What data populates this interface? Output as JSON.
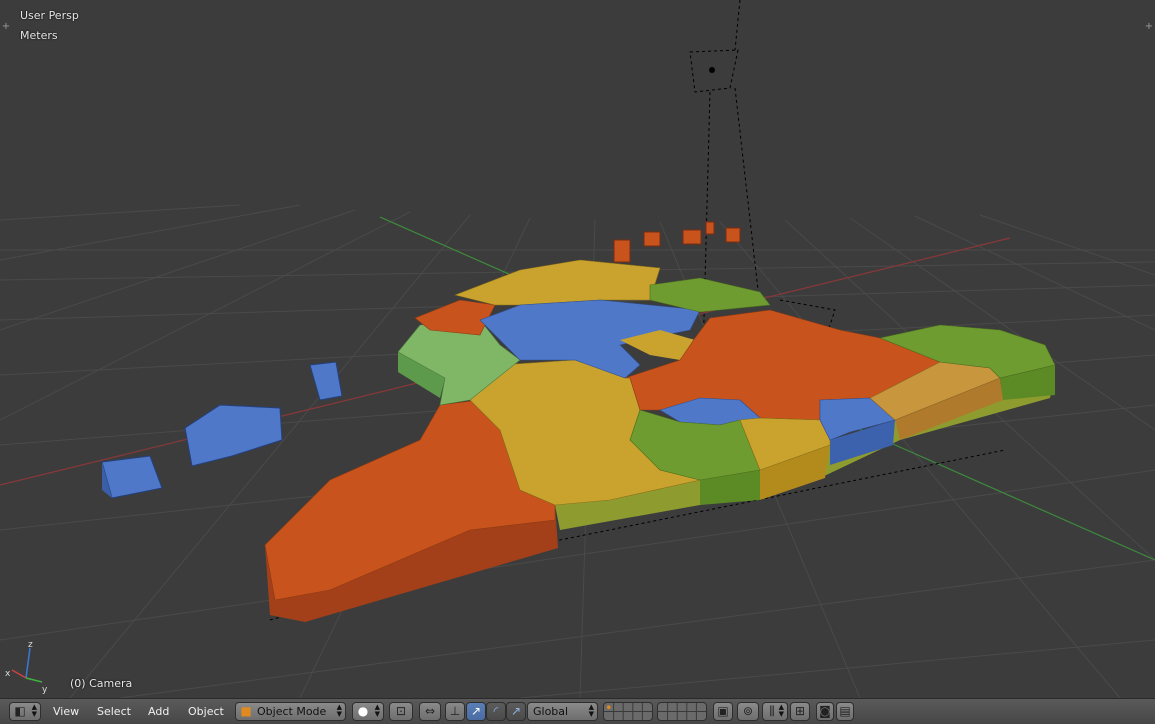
{
  "viewport": {
    "view_name": "User Persp",
    "units": "Meters",
    "active_object": "(0) Camera",
    "axis_gizmo": {
      "x": "x",
      "y": "y",
      "z": "z"
    }
  },
  "header": {
    "editor_type_icon": "3d-view-icon",
    "menus": {
      "view": "View",
      "select": "Select",
      "add": "Add",
      "object": "Object"
    },
    "mode": {
      "label": "Object Mode",
      "icon": "object-mode-cube-icon"
    },
    "shading_icon": "solid-shading-icon",
    "pivot_icon": "pivot-point-icon",
    "manipulator_icons": [
      "manipulator-toggle-icon",
      "translate-icon",
      "rotate-icon",
      "scale-icon"
    ],
    "orientation": "Global",
    "layer_count": 20,
    "right_icons": [
      "lock-layers-icon",
      "proportional-edit-icon",
      "snap-icon",
      "snap-element-icon",
      "opengl-render-icon",
      "opengl-animation-icon"
    ]
  },
  "colors": {
    "viewport_bg": "#3c3c3c",
    "grid": "#494949",
    "x_axis": "#8a3838",
    "y_axis": "#3d8a3d",
    "region_orange": "#c8531d",
    "region_blue": "#4f78c9",
    "region_gold": "#c9a32e",
    "region_green": "#6e9c30",
    "region_lightgreen": "#7fb766",
    "region_tan": "#c8963d"
  }
}
